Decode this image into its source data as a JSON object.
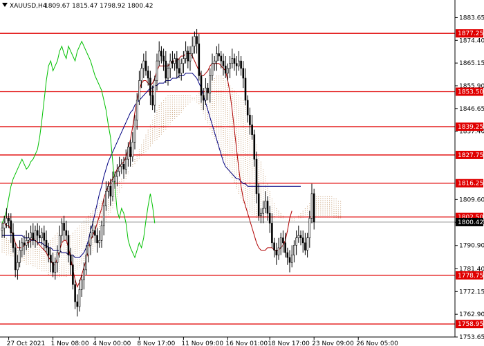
{
  "header": {
    "symbol": "XAUUSD,H4",
    "ohlc": "1809.67 1815.47 1798.92 1800.42"
  },
  "colors": {
    "background": "#ffffff",
    "levels": "#e00000",
    "label_fill": "#e00000",
    "label_text": "#ffffff",
    "current_fill": "#000000",
    "current_text": "#ffffff",
    "candle": "#000000",
    "kijun": "#000080",
    "tenkan": "#b00000",
    "chikou": "#00c000",
    "cloud": "#c8a078"
  },
  "chart_data": {
    "type": "candlestick",
    "title": "XAUUSD,H4",
    "ylim": [
      1753.65,
      1888.0
    ],
    "y_ticks": [
      "1883.65",
      "1874.40",
      "1865.15",
      "1855.90",
      "1846.65",
      "1837.40",
      "1809.60",
      "1800.35",
      "1790.90",
      "1781.40",
      "1772.15",
      "1762.90",
      "1753.65"
    ],
    "x_ticks": [
      {
        "label": "27 Oct 2021",
        "idx": 3
      },
      {
        "label": "1 Nov 08:00",
        "idx": 23
      },
      {
        "label": "4 Nov 00:00",
        "idx": 42
      },
      {
        "label": "8 Nov 17:00",
        "idx": 62
      },
      {
        "label": "11 Nov 09:00",
        "idx": 82
      },
      {
        "label": "16 Nov 01:00",
        "idx": 102
      },
      {
        "label": "18 Nov 17:00",
        "idx": 121
      },
      {
        "label": "23 Nov 09:00",
        "idx": 141
      },
      {
        "label": "26 Nov 05:00",
        "idx": 161
      }
    ],
    "levels": [
      "1877.25",
      "1853.50",
      "1839.25",
      "1827.75",
      "1816.25",
      "1802.50",
      "1778.75",
      "1758.95"
    ],
    "current_price": "1800.42",
    "close": [
      1798,
      1800,
      1802,
      1801,
      1796,
      1790,
      1781,
      1784,
      1789,
      1792,
      1791,
      1793,
      1794,
      1796,
      1793,
      1797,
      1795,
      1794,
      1796,
      1793,
      1790,
      1787,
      1784,
      1780,
      1784,
      1788,
      1795,
      1800,
      1797,
      1795,
      1787,
      1783,
      1775,
      1768,
      1766,
      1773,
      1777,
      1781,
      1787,
      1791,
      1796,
      1797,
      1795,
      1792,
      1793,
      1799,
      1807,
      1813,
      1815,
      1811,
      1817,
      1819,
      1821,
      1823,
      1824,
      1822,
      1826,
      1831,
      1827,
      1833,
      1842,
      1850,
      1858,
      1863,
      1866,
      1862,
      1859,
      1852,
      1848,
      1858,
      1866,
      1870,
      1868,
      1866,
      1859,
      1863,
      1866,
      1865,
      1867,
      1863,
      1861,
      1865,
      1867,
      1870,
      1866,
      1869,
      1872,
      1876,
      1873,
      1860,
      1852,
      1850,
      1855,
      1853,
      1860,
      1865,
      1866,
      1869,
      1868,
      1866,
      1864,
      1861,
      1863,
      1865,
      1867,
      1865,
      1864,
      1866,
      1863,
      1859,
      1850,
      1844,
      1840,
      1836,
      1826,
      1812,
      1803,
      1804,
      1806,
      1809,
      1804,
      1800,
      1792,
      1789,
      1787,
      1790,
      1794,
      1792,
      1788,
      1786,
      1784,
      1787,
      1791,
      1794,
      1795,
      1794,
      1792,
      1789,
      1794,
      1802,
      1812,
      1800.42
    ],
    "tenkan": [
      1800,
      1800,
      1799,
      1799,
      1797,
      1795,
      1792,
      1790,
      1790,
      1790,
      1791,
      1792,
      1792,
      1793,
      1794,
      1793,
      1792,
      1791,
      1790,
      1789,
      1788,
      1786,
      1785,
      1783,
      1783,
      1786,
      1789,
      1792,
      1793,
      1793,
      1790,
      1786,
      1781,
      1777,
      1774,
      1776,
      1779,
      1782,
      1785,
      1789,
      1793,
      1795,
      1797,
      1800,
      1803,
      1806,
      1810,
      1813,
      1815,
      1817,
      1818,
      1820,
      1822,
      1823,
      1824,
      1825,
      1827,
      1830,
      1834,
      1839,
      1845,
      1850,
      1854,
      1857,
      1858,
      1858,
      1857,
      1856,
      1857,
      1859,
      1862,
      1864,
      1864,
      1864,
      1864,
      1864,
      1865,
      1866,
      1866,
      1866,
      1867,
      1868,
      1868,
      1869,
      1869,
      1869,
      1868,
      1866,
      1864,
      1862,
      1860,
      1860,
      1861,
      1862,
      1864,
      1865,
      1865,
      1865,
      1865,
      1864,
      1863,
      1862,
      1858,
      1853,
      1846,
      1838,
      1830,
      1822,
      1815,
      1810,
      1807,
      1804,
      1801,
      1798,
      1795,
      1792,
      1790,
      1789,
      1789,
      1789,
      1790,
      1790,
      1790,
      1789,
      1789,
      1789,
      1790,
      1791,
      1793,
      1797,
      1802,
      1805
    ],
    "kijun": [
      1795,
      1795,
      1795,
      1795,
      1795,
      1795,
      1795,
      1795,
      1795,
      1795,
      1794,
      1794,
      1794,
      1793,
      1793,
      1793,
      1792,
      1792,
      1792,
      1791,
      1791,
      1790,
      1790,
      1789,
      1789,
      1789,
      1789,
      1788,
      1788,
      1788,
      1787,
      1787,
      1787,
      1786,
      1786,
      1786,
      1787,
      1788,
      1790,
      1793,
      1797,
      1800,
      1804,
      1808,
      1812,
      1815,
      1819,
      1822,
      1825,
      1827,
      1829,
      1831,
      1833,
      1835,
      1837,
      1839,
      1841,
      1843,
      1845,
      1846,
      1848,
      1849,
      1850,
      1851,
      1852,
      1853,
      1854,
      1855,
      1855,
      1856,
      1856,
      1857,
      1857,
      1857,
      1858,
      1858,
      1858,
      1859,
      1859,
      1859,
      1860,
      1860,
      1860,
      1861,
      1861,
      1861,
      1861,
      1860,
      1859,
      1857,
      1855,
      1852,
      1849,
      1846,
      1843,
      1840,
      1837,
      1834,
      1831,
      1828,
      1825,
      1823,
      1822,
      1821,
      1820,
      1819,
      1818,
      1818,
      1817,
      1816,
      1816,
      1815,
      1815,
      1815,
      1815,
      1815,
      1815,
      1815,
      1815,
      1815,
      1815,
      1815,
      1815,
      1815,
      1815,
      1815,
      1815,
      1815,
      1815,
      1815,
      1815,
      1815,
      1815,
      1815,
      1815,
      1815
    ],
    "chikou": [
      1800,
      1802,
      1805,
      1810,
      1815,
      1818,
      1820,
      1822,
      1824,
      1826,
      1824,
      1822,
      1823,
      1825,
      1826,
      1828,
      1830,
      1835,
      1842,
      1850,
      1858,
      1864,
      1866,
      1862,
      1864,
      1866,
      1870,
      1872,
      1869,
      1867,
      1872,
      1870,
      1868,
      1866,
      1870,
      1872,
      1874,
      1872,
      1870,
      1868,
      1866,
      1863,
      1860,
      1858,
      1856,
      1854,
      1850,
      1846,
      1840,
      1835,
      1825,
      1815,
      1805,
      1802,
      1806,
      1804,
      1800,
      1793,
      1790,
      1788,
      1786,
      1789,
      1792,
      1790,
      1794,
      1801,
      1807,
      1812,
      1807,
      1800
    ],
    "cloud_a": [
      1800,
      1799,
      1798,
      1797,
      1796,
      1795,
      1794,
      1793,
      1792,
      1791,
      1790,
      1789,
      1789,
      1789,
      1790,
      1791,
      1792,
      1793,
      1793,
      1792,
      1792,
      1791,
      1790,
      1790,
      1791,
      1792,
      1793,
      1794,
      1795,
      1796,
      1797,
      1798,
      1798,
      1797,
      1796,
      1795,
      1796,
      1797,
      1798,
      1799,
      1800,
      1801,
      1802,
      1803,
      1804,
      1805,
      1806,
      1807,
      1808,
      1809,
      1810,
      1811,
      1812,
      1813,
      1814,
      1815,
      1816,
      1817,
      1818,
      1819,
      1820,
      1821,
      1822,
      1823,
      1824,
      1825,
      1826,
      1827,
      1828,
      1829,
      1830,
      1831,
      1832,
      1833,
      1834,
      1835,
      1836,
      1837,
      1838,
      1839,
      1840,
      1841,
      1842,
      1843,
      1844,
      1845,
      1846,
      1847,
      1848,
      1849,
      1850,
      1851,
      1852,
      1853,
      1854,
      1855,
      1856,
      1857,
      1858,
      1859,
      1859,
      1860,
      1860,
      1860,
      1859,
      1858,
      1857,
      1856,
      1855,
      1854,
      1853,
      1852,
      1851,
      1850,
      1848,
      1846,
      1843,
      1840,
      1836,
      1832,
      1828,
      1825,
      1822,
      1819,
      1816,
      1813,
      1810,
      1808,
      1806,
      1805,
      1804,
      1803,
      1802,
      1802,
      1801,
      1801,
      1801,
      1802,
      1803,
      1804,
      1805,
      1806,
      1807,
      1808,
      1809,
      1810,
      1811,
      1811,
      1811,
      1811,
      1811,
      1811,
      1811,
      1811,
      1810,
      1810,
      1809,
      1809
    ],
    "cloud_b": [
      1790,
      1790,
      1789,
      1789,
      1788,
      1788,
      1787,
      1787,
      1786,
      1786,
      1785,
      1785,
      1784,
      1784,
      1784,
      1783,
      1783,
      1783,
      1782,
      1782,
      1781,
      1781,
      1780,
      1780,
      1780,
      1779,
      1779,
      1779,
      1778,
      1778,
      1778,
      1778,
      1778,
      1778,
      1779,
      1779,
      1780,
      1780,
      1781,
      1782,
      1783,
      1784,
      1785,
      1786,
      1787,
      1788,
      1790,
      1792,
      1794,
      1796,
      1798,
      1800,
      1802,
      1804,
      1806,
      1808,
      1810,
      1812,
      1814,
      1816,
      1818,
      1820,
      1822,
      1824,
      1826,
      1828,
      1830,
      1832,
      1834,
      1836,
      1838,
      1840,
      1842,
      1844,
      1846,
      1848,
      1849,
      1850,
      1851,
      1852,
      1852,
      1852,
      1852,
      1852,
      1852,
      1852,
      1852,
      1852,
      1852,
      1852,
      1851,
      1850,
      1849,
      1848,
      1846,
      1844,
      1842,
      1840,
      1838,
      1836,
      1834,
      1832,
      1830,
      1828,
      1826,
      1824,
      1822,
      1820,
      1818,
      1816,
      1814,
      1812,
      1810,
      1808,
      1806,
      1805,
      1804,
      1803,
      1803,
      1802,
      1802,
      1802,
      1802,
      1802,
      1802,
      1802,
      1802,
      1802,
      1802,
      1802,
      1802,
      1802,
      1802,
      1802,
      1802,
      1802,
      1802,
      1802,
      1802,
      1802,
      1802,
      1802,
      1802,
      1802,
      1802,
      1802,
      1802,
      1802,
      1802,
      1802,
      1802,
      1802,
      1802,
      1802,
      1802,
      1802,
      1802,
      1802
    ]
  }
}
